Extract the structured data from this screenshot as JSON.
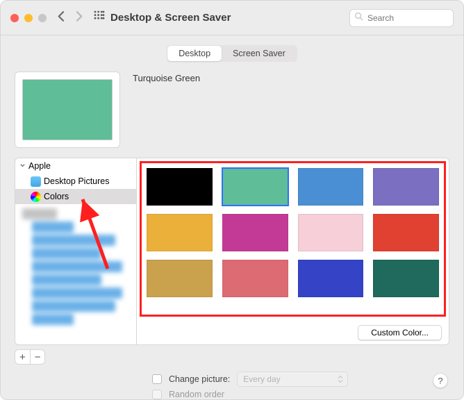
{
  "window": {
    "title": "Desktop & Screen Saver"
  },
  "search": {
    "placeholder": "Search"
  },
  "tabs": {
    "desktop": "Desktop",
    "screensaver": "Screen Saver"
  },
  "preview": {
    "name": "Turquoise Green",
    "color": "#5fbd97"
  },
  "sidebar": {
    "root": "Apple",
    "items": [
      {
        "label": "Desktop Pictures",
        "icon": "folder"
      },
      {
        "label": "Colors",
        "icon": "color-wheel"
      }
    ]
  },
  "colors": [
    {
      "hex": "#000000",
      "selected": false
    },
    {
      "hex": "#5fbd97",
      "selected": true
    },
    {
      "hex": "#4a8fd4",
      "selected": false
    },
    {
      "hex": "#7a6fc0",
      "selected": false
    },
    {
      "hex": "#eab03a",
      "selected": false
    },
    {
      "hex": "#c33a96",
      "selected": false
    },
    {
      "hex": "#f6cfd8",
      "selected": false
    },
    {
      "hex": "#e14131",
      "selected": false
    },
    {
      "hex": "#caa24e",
      "selected": false
    },
    {
      "hex": "#dd6b73",
      "selected": false
    },
    {
      "hex": "#3544c6",
      "selected": false
    },
    {
      "hex": "#1f6a5c",
      "selected": false
    }
  ],
  "buttons": {
    "custom_color": "Custom Color..."
  },
  "options": {
    "change_picture_label": "Change picture:",
    "interval": "Every day",
    "random_label": "Random order"
  },
  "help": {
    "glyph": "?"
  }
}
